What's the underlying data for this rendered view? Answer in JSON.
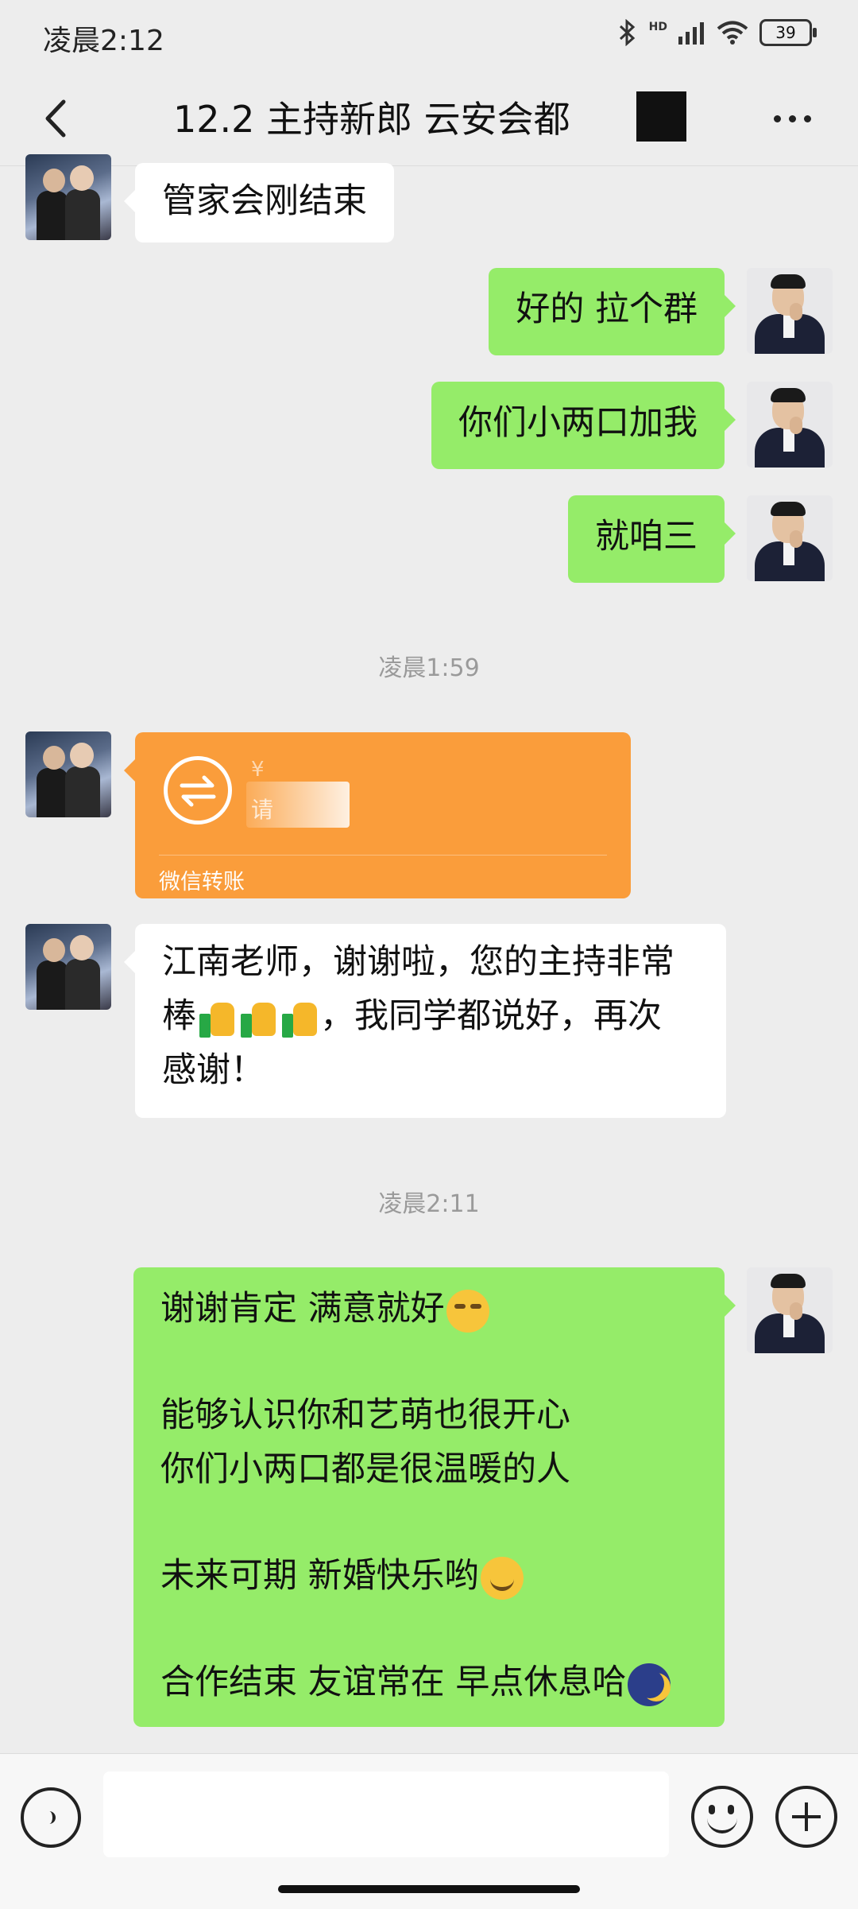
{
  "status_bar": {
    "time": "凌晨2:12",
    "battery": "39",
    "network": "HD"
  },
  "header": {
    "title": "12.2 主持新郎 云安会都 ",
    "back_icon": "chevron-left-icon",
    "more_icon": "more-dots-icon"
  },
  "messages": [
    {
      "side": "left",
      "text": "管家会刚结束"
    },
    {
      "side": "right",
      "text": "好的 拉个群"
    },
    {
      "side": "right",
      "text": "你们小两口加我"
    },
    {
      "side": "right",
      "text": "就咱三"
    }
  ],
  "timestamp_1": "凌晨1:59",
  "transfer": {
    "label": "微信转账",
    "amount_hint": "¥",
    "note_hint": "请"
  },
  "msg_thanks": {
    "line1": "江南老师，谢谢啦，您的主持非常",
    "line2_prefix": "棒",
    "line2_suffix": "，我同学都说好，再次",
    "line3": "感谢！"
  },
  "timestamp_2": "凌晨2:11",
  "msg_reply": {
    "line1": "谢谢肯定 满意就好",
    "line2": "能够认识你和艺萌也很开心",
    "line3": "你们小两口都是很温暖的人",
    "line4": "未来可期 新婚快乐哟",
    "line5": "合作结束 友谊常在 早点休息哈"
  },
  "input": {
    "value": ""
  }
}
